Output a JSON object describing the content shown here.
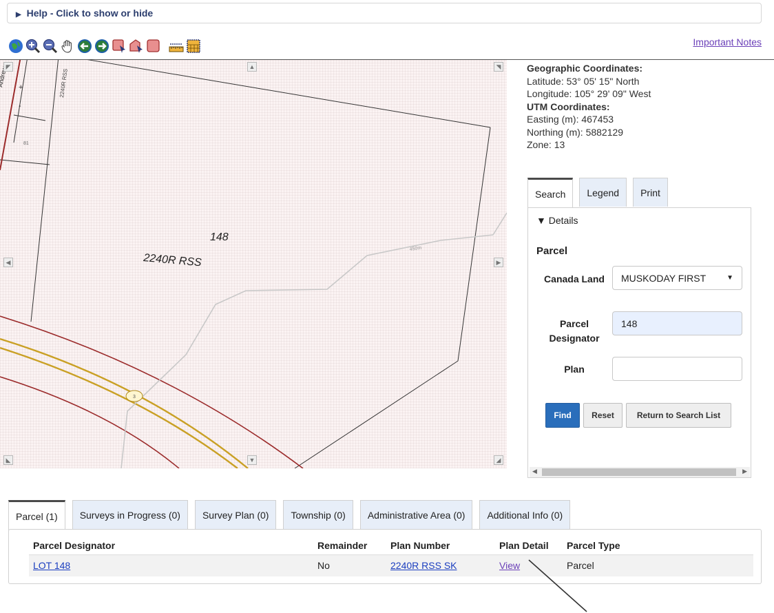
{
  "help": {
    "label": "Help - Click to show or hide"
  },
  "toolbar": {
    "tools": [
      "globe-icon",
      "zoom-in-icon",
      "zoom-out-icon",
      "pan-hand-icon",
      "back-arrow-icon",
      "forward-arrow-icon",
      "select-rectangle-icon",
      "select-polygon-icon",
      "clear-selection-icon",
      "measure-ruler-icon",
      "measure-area-icon"
    ],
    "important_notes": "Important Notes"
  },
  "map": {
    "parcel_number": "148",
    "plan_label": "2240R RSS",
    "contour_label": "450m",
    "small_lot": "81",
    "road_label": "3",
    "top_street": "Andrew",
    "top_plan": "2240R RSS"
  },
  "coords": {
    "geo_header": "Geographic Coordinates:",
    "latitude": "Latitude: 53° 05' 15\" North",
    "longitude": "Longitude: 105° 29' 09\" West",
    "utm_header": "UTM Coordinates:",
    "easting": "Easting (m): 467453",
    "northing": "Northing (m): 5882129",
    "zone": "Zone: 13"
  },
  "right_tabs": [
    "Search",
    "Legend",
    "Print"
  ],
  "search": {
    "details": "▼ Details",
    "heading": "Parcel",
    "canada_land_label": "Canada Land",
    "canada_land_value": "MUSKODAY FIRST",
    "parcel_designator_label": "Parcel Designator",
    "parcel_designator_value": "148",
    "plan_label": "Plan",
    "plan_value": "",
    "find": "Find",
    "reset": "Reset",
    "return": "Return to Search List"
  },
  "bottom_tabs": [
    "Parcel (1)",
    "Surveys in Progress (0)",
    "Survey Plan (0)",
    "Township (0)",
    "Administrative Area (0)",
    "Additional Info (0)"
  ],
  "results": {
    "headers": [
      "Parcel Designator",
      "Remainder",
      "Plan Number",
      "Plan Detail",
      "Parcel Type"
    ],
    "rows": [
      {
        "designator": "LOT 148",
        "remainder": "No",
        "plan_number": "2240R RSS SK",
        "plan_detail": "View",
        "parcel_type": "Parcel"
      }
    ]
  }
}
